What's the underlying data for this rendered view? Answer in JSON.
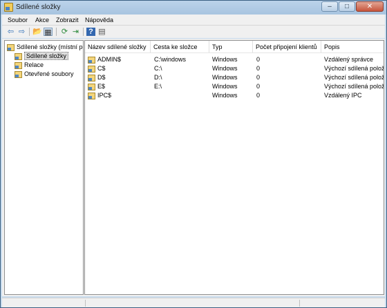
{
  "window": {
    "title": "Sdílené složky"
  },
  "menu": [
    {
      "label": "Soubor"
    },
    {
      "label": "Akce"
    },
    {
      "label": "Zobrazit"
    },
    {
      "label": "Nápověda"
    }
  ],
  "toolbar": {
    "icons": [
      "back-arrow-icon",
      "forward-arrow-icon",
      "up-folder-icon",
      "show-hide-tree-icon",
      "refresh-icon",
      "export-list-icon",
      "help-icon",
      "properties-icon"
    ],
    "glyphs": [
      "⇦",
      "⇨",
      "📂",
      "▦",
      "⟳",
      "⇥",
      "?",
      "▤"
    ]
  },
  "tree": {
    "root": "Sdílené složky (místní po",
    "items": [
      "Sdílené složky",
      "Relace",
      "Otevřené soubory"
    ],
    "selected_index": 0
  },
  "table": {
    "columns": [
      "Název sdílené složky",
      "Cesta ke složce",
      "Typ",
      "Počet připojení klientů",
      "Popis"
    ],
    "rows": [
      [
        "ADMIN$",
        "C:\\windows",
        "Windows",
        "0",
        "Vzdálený správce"
      ],
      [
        "C$",
        "C:\\",
        "Windows",
        "0",
        "Výchozí sdílená položka"
      ],
      [
        "D$",
        "D:\\",
        "Windows",
        "0",
        "Výchozí sdílená položka"
      ],
      [
        "E$",
        "E:\\",
        "Windows",
        "0",
        "Výchozí sdílená položka"
      ],
      [
        "IPC$",
        "",
        "Windows",
        "0",
        "Vzdálený IPC"
      ]
    ]
  },
  "colors": {
    "titlebar": "#a8c4e0",
    "frame": "#c9dcee",
    "close": "#c7553c"
  }
}
